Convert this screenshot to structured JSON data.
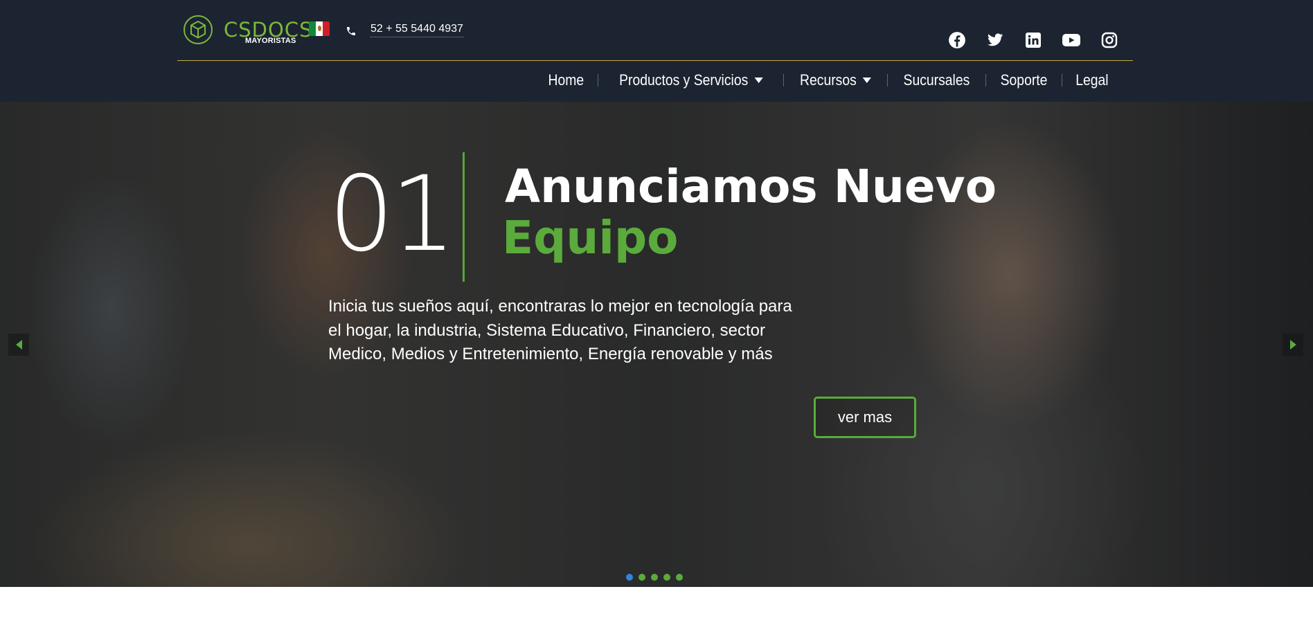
{
  "header": {
    "logo": {
      "word": "CSDOCS",
      "sub": "MAYORISTAS"
    },
    "country_flag": "mexico-flag",
    "phone": "52 + 55 5440 4937",
    "socials": [
      "facebook-icon",
      "twitter-icon",
      "linkedin-icon",
      "youtube-icon",
      "instagram-icon"
    ],
    "nav": {
      "home": "Home",
      "productos": "Productos y Servicios",
      "recursos": "Recursos",
      "sucursales": "Sucursales",
      "soporte": "Soporte",
      "legal": "Legal"
    }
  },
  "hero": {
    "slide_number": "01",
    "headline": "Anunciamos Nuevo",
    "headline_accent": "Equipo",
    "description": "Inicia tus sueños aquí, encontraras lo mejor en tecnología para el hogar, la industria, Sistema Educativo, Financiero, sector Medico, Medios y Entretenimiento, Energía renovable y más",
    "cta_label": "ver mas",
    "slides_total": 5,
    "active_slide": 1
  },
  "colors": {
    "header_bg": "#1c2431",
    "accent_green": "#5aab3c",
    "gold_line": "#c9a848",
    "active_dot": "#2f86e0"
  }
}
